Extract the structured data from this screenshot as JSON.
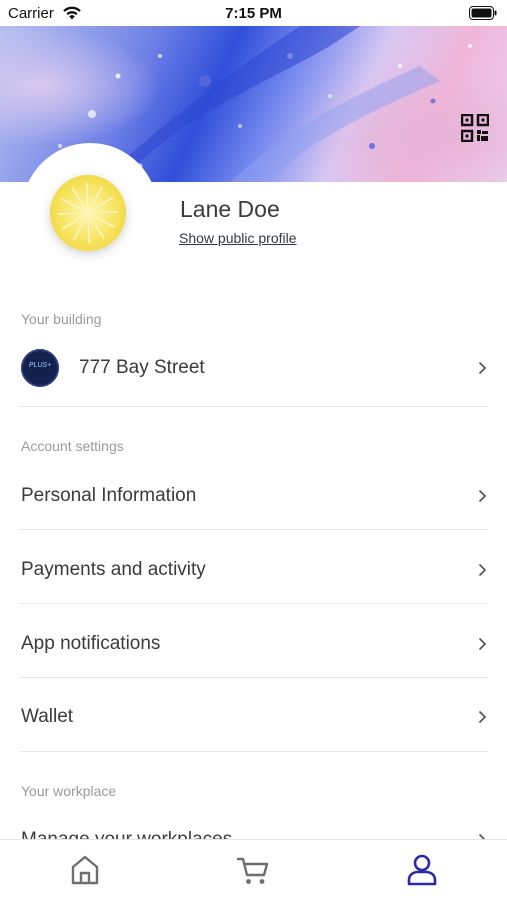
{
  "status_bar": {
    "carrier": "Carrier",
    "time": "7:15 PM"
  },
  "profile": {
    "name": "Lane Doe",
    "public_profile_link": "Show public profile"
  },
  "sections": {
    "building_label": "Your building",
    "building_name": "777 Bay Street",
    "building_logo_text": "PLUS+",
    "account_label": "Account settings",
    "account_items": [
      "Personal Information",
      "Payments and activity",
      "App notifications",
      "Wallet"
    ],
    "workplace_label": "Your workplace",
    "workplace_items": [
      "Manage your workplaces"
    ]
  },
  "tab_bar": {
    "tabs": [
      "home-icon",
      "cart-icon",
      "profile-icon"
    ],
    "active_tab": "profile-icon",
    "active_color": "#2b2aa6",
    "inactive_color": "#6e6e6e"
  },
  "colors": {
    "text_primary": "#3b3b3b",
    "section_label": "#9a9a9a",
    "divider": "#e7e7e7"
  }
}
